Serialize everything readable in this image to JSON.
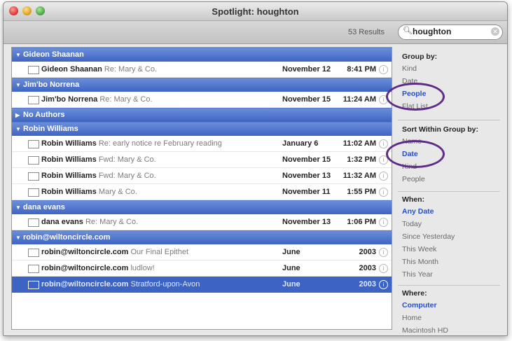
{
  "window": {
    "title": "Spotlight: houghton"
  },
  "toolbar": {
    "results": "53 Results",
    "search_value": "houghton"
  },
  "groups": [
    {
      "name": "Gideon Shaanan",
      "expanded": true,
      "items": [
        {
          "sender": "Gideon Shaanan",
          "subject": "Re: Mary & Co.",
          "date": "November 12",
          "time": "8:41 PM"
        }
      ]
    },
    {
      "name": "Jim'bo Norrena",
      "expanded": true,
      "items": [
        {
          "sender": "Jim'bo Norrena",
          "subject": "Re: Mary & Co.",
          "date": "November 15",
          "time": "11:24 AM"
        }
      ]
    },
    {
      "name": "No Authors",
      "expanded": false,
      "items": []
    },
    {
      "name": "Robin Williams",
      "expanded": true,
      "items": [
        {
          "sender": "Robin Williams",
          "subject": "Re: early notice re February reading",
          "date": "January 6",
          "time": "11:02 AM"
        },
        {
          "sender": "Robin Williams",
          "subject": "Fwd: Mary & Co.",
          "date": "November 15",
          "time": "1:32 PM"
        },
        {
          "sender": "Robin Williams",
          "subject": "Fwd: Mary & Co.",
          "date": "November 13",
          "time": "11:32 AM"
        },
        {
          "sender": "Robin Williams",
          "subject": "Mary & Co.",
          "date": "November 11",
          "time": "1:55 PM"
        }
      ]
    },
    {
      "name": "dana evans",
      "expanded": true,
      "items": [
        {
          "sender": "dana evans",
          "subject": "Re: Mary & Co.",
          "date": "November 13",
          "time": "1:06 PM"
        }
      ]
    },
    {
      "name": "robin@wiltoncircle.com",
      "expanded": true,
      "items": [
        {
          "sender": "robin@wiltoncircle.com",
          "subject": "Our Final Epithet",
          "date": "June",
          "time": "2003"
        },
        {
          "sender": "robin@wiltoncircle.com",
          "subject": "ludlow!",
          "date": "June",
          "time": "2003"
        },
        {
          "sender": "robin@wiltoncircle.com",
          "subject": "Stratford-upon-Avon",
          "date": "June",
          "time": "2003",
          "selected": true
        }
      ]
    }
  ],
  "sidebar": {
    "group_by": {
      "heading": "Group by:",
      "options": [
        "Kind",
        "Date",
        "People",
        "Flat List"
      ],
      "selected": "People"
    },
    "sort_by": {
      "heading": "Sort Within Group by:",
      "options": [
        "Name",
        "Date",
        "Kind",
        "People"
      ],
      "selected": "Date"
    },
    "when": {
      "heading": "When:",
      "options": [
        "Any Date",
        "Today",
        "Since Yesterday",
        "This Week",
        "This Month",
        "This Year"
      ],
      "selected": "Any Date"
    },
    "where": {
      "heading": "Where:",
      "options": [
        "Computer",
        "Home",
        "Macintosh HD"
      ],
      "selected": "Computer"
    }
  },
  "colors": {
    "group_header": "#4a6fcb",
    "selected_row": "#3d64c4",
    "highlight_ring": "#5e2b86",
    "selected_option": "#2a4fbf"
  }
}
